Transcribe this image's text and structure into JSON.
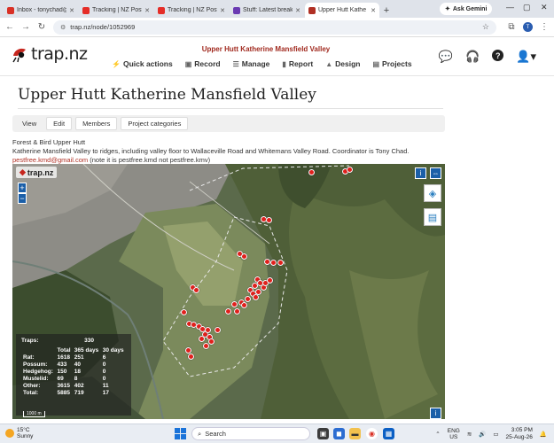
{
  "browser": {
    "tabs": [
      {
        "title": "Inbox - tonychad@",
        "favicon_color": "#d93025",
        "active": false
      },
      {
        "title": "Tracking | NZ Post",
        "favicon_color": "#e52d27",
        "active": false
      },
      {
        "title": "Tracking | NZ Post",
        "favicon_color": "#e52d27",
        "active": false
      },
      {
        "title": "Stuff: Latest breaki",
        "favicon_color": "#6a3ab2",
        "active": false
      },
      {
        "title": "Upper Hutt Kathe",
        "favicon_color": "#b03024",
        "active": true
      }
    ],
    "new_tab": "+",
    "gemini_label": "Ask Gemini",
    "url": "trap.nz/node/1052969",
    "profile_initial": "T"
  },
  "site": {
    "logo_text": "trap.nz",
    "project_title": "Upper Hutt Katherine Mansfield Valley",
    "nav": [
      {
        "label": "Quick actions",
        "icon": "lightning-icon"
      },
      {
        "label": "Record",
        "icon": "record-icon"
      },
      {
        "label": "Manage",
        "icon": "list-icon"
      },
      {
        "label": "Report",
        "icon": "chart-icon"
      },
      {
        "label": "Design",
        "icon": "design-icon"
      },
      {
        "label": "Projects",
        "icon": "projects-icon"
      }
    ]
  },
  "page": {
    "title": "Upper Hutt Katherine Mansfield Valley",
    "subtabs": [
      "View",
      "Edit",
      "Members",
      "Project categories"
    ],
    "org": "Forest & Bird Upper Hutt",
    "description": "Katherine Mansfield Valley to ridges, including valley floor to Wallaceville Road and Whitemans Valley Road. Coordinator is Tony Chad.",
    "email": "pestfree.kmd@gmail.com",
    "email_note": " (note it is pestfree.kmd not pestfree.kmv)"
  },
  "map": {
    "logo_text": "trap.nz",
    "zoom_in": "+",
    "zoom_out": "−",
    "scale_label": "1000 m",
    "info_label": "i",
    "stats": {
      "traps_label": "Traps:",
      "traps_count": "330",
      "headers": [
        "",
        "Total",
        "365 days",
        "30 days"
      ],
      "rows": [
        [
          "Rat:",
          "1618",
          "251",
          "6"
        ],
        [
          "Possum:",
          "433",
          "40",
          "0"
        ],
        [
          "Hedgehog:",
          "150",
          "18",
          "0"
        ],
        [
          "Mustelid:",
          "69",
          "8",
          "0"
        ],
        [
          "Other:",
          "3615",
          "402",
          "11"
        ],
        [
          "Total:",
          "5885",
          "719",
          "17"
        ]
      ]
    }
  },
  "taskbar": {
    "temperature": "15°C",
    "weather": "Sunny",
    "search_placeholder": "Search",
    "lang": "ENG",
    "region": "US",
    "time": "3:05 PM",
    "date": "25-Aug-26"
  }
}
